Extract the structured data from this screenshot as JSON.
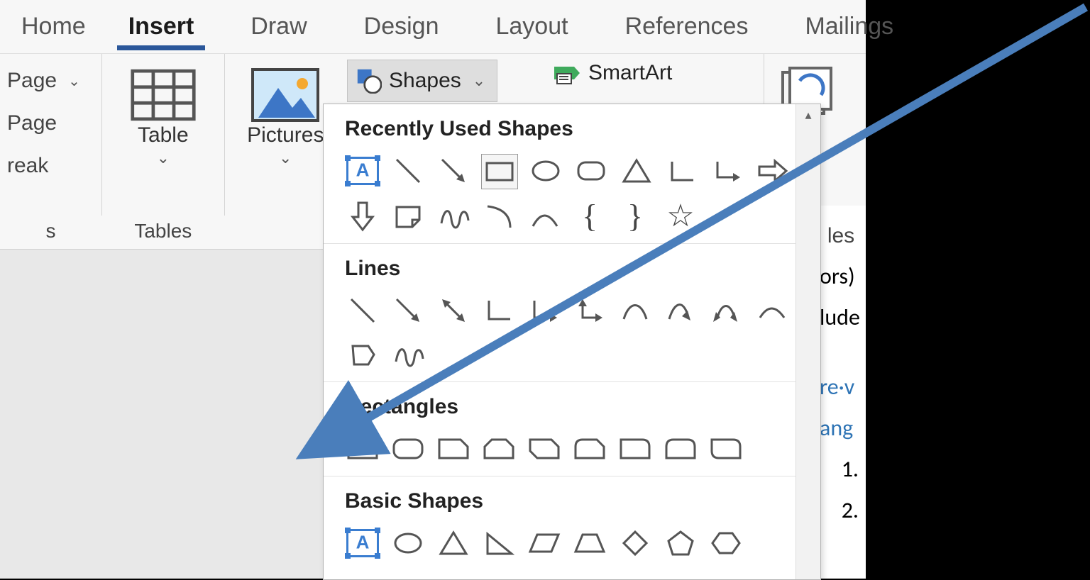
{
  "tabs": {
    "home": "Home",
    "insert": "Insert",
    "draw": "Draw",
    "design": "Design",
    "layout": "Layout",
    "references": "References",
    "mailings": "Mailings",
    "selected": "insert"
  },
  "ribbon": {
    "pages": {
      "cover": "Page",
      "blank": "Page",
      "break": "reak",
      "group_label": "s"
    },
    "table": {
      "label": "Table",
      "group_label": "Tables"
    },
    "pictures": {
      "label": "Pictures"
    },
    "shapes_button": "Shapes",
    "smartart": "SmartArt",
    "right_group_label": "les"
  },
  "shapes_dropdown": {
    "sections": {
      "recent": "Recently Used Shapes",
      "lines": "Lines",
      "rectangles": "Rectangles",
      "basic": "Basic Shapes"
    },
    "recent_items": [
      "text-box",
      "line",
      "arrow-line",
      "rectangle",
      "oval",
      "rounded-rectangle",
      "triangle",
      "l-shape",
      "elbow-connector",
      "right-arrow",
      "down-arrow",
      "folded-corner",
      "scribble",
      "arc-right",
      "arc-left",
      "left-brace",
      "right-brace",
      "star"
    ],
    "lines_items": [
      "line",
      "arrow-line",
      "double-arrow-line",
      "elbow",
      "elbow-arrow",
      "elbow-double-arrow",
      "curve",
      "curve-arrow",
      "curve-double-arrow",
      "curve-connector",
      "freeform-shape",
      "scribble"
    ],
    "rectangles_items": [
      "rectangle",
      "rounded-rectangle",
      "single-snip",
      "snip-top",
      "snip-diagonal",
      "snip-round",
      "round-single",
      "round-top",
      "round-diagonal"
    ],
    "basic_items": [
      "text-box",
      "oval",
      "triangle",
      "right-triangle",
      "parallelogram",
      "trapezoid",
      "diamond",
      "pentagon",
      "hexagon"
    ]
  },
  "doc_fragment": {
    "l1": "ors)",
    "l2": "lude",
    "l3": "re·v",
    "l4": "ang",
    "n1": "1.",
    "n2": "2."
  }
}
